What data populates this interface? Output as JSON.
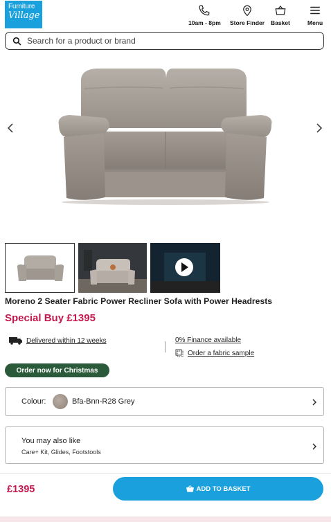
{
  "header": {
    "logo_line1": "Furniture",
    "logo_line2": "Village",
    "nav": {
      "hours": "10am - 8pm",
      "store_finder": "Store Finder",
      "basket": "Basket",
      "menu": "Menu"
    }
  },
  "search": {
    "placeholder": "Search for a product or brand"
  },
  "product": {
    "title": "Moreno 2 Seater Fabric Power Recliner Sofa with Power Headrests",
    "special_price": "Special Buy £1395",
    "thumbnails": [
      "sofa-cutout",
      "sofa-room-scene",
      "video"
    ]
  },
  "features": {
    "delivery": "Delivered within 12 weeks",
    "finance": "0% Finance available",
    "sample": "Order a fabric sample"
  },
  "promo_badge": "Order now for Christmas",
  "colour": {
    "label": "Colour:",
    "value": "Bfa-Bnn-R28 Grey"
  },
  "also_like": {
    "heading": "You may also like",
    "items": "Care+ Kit, Glides, Footstools"
  },
  "bottom_bar": {
    "price": "£1395",
    "button": "ADD TO BASKET"
  },
  "colors": {
    "brand_blue": "#1aa0dc",
    "price_red": "#c4194f",
    "promo_green": "#2a5a3a"
  },
  "icons": [
    "phone-icon",
    "location-pin-icon",
    "basket-icon",
    "hamburger-menu-icon",
    "search-icon",
    "chevron-left-icon",
    "chevron-right-icon",
    "play-icon",
    "delivery-truck-icon",
    "fabric-sample-icon",
    "basket-small-icon"
  ]
}
